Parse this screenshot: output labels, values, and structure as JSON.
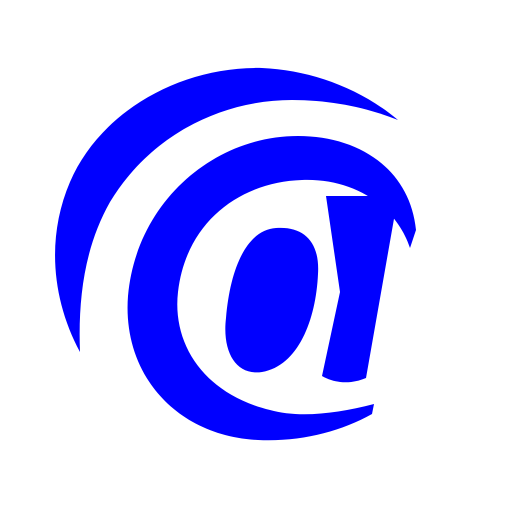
{
  "icon": {
    "name": "at-sign-icon",
    "symbol": "@",
    "color": "#0000FF",
    "background": "#FFFFFF"
  }
}
